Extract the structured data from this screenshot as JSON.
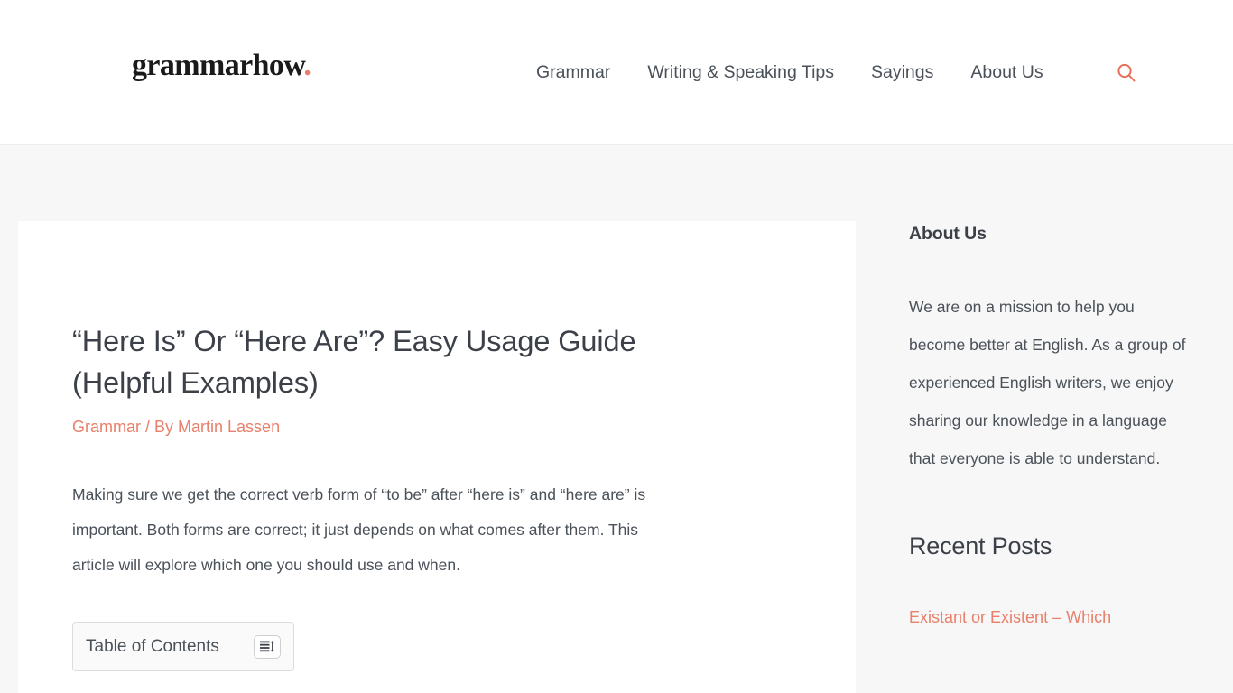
{
  "header": {
    "logo_text": "grammarhow",
    "logo_dot": ".",
    "nav": [
      {
        "label": "Grammar",
        "name": "nav-item-grammar"
      },
      {
        "label": "Writing & Speaking Tips",
        "name": "nav-item-writing-speaking-tips"
      },
      {
        "label": "Sayings",
        "name": "nav-item-sayings"
      },
      {
        "label": "About Us",
        "name": "nav-item-about-us"
      }
    ],
    "search_icon": "search-icon"
  },
  "article": {
    "title": "“Here Is” Or “Here Are”? Easy Usage Guide (Helpful Examples)",
    "meta": {
      "category": "Grammar",
      "separator": "/",
      "byline": "By Martin Lassen"
    },
    "paragraph": "Making sure we get the correct verb form of “to be” after “here is” and “here are” is important. Both forms are correct; it just depends on what comes after them. This article will explore which one you should use and when.",
    "toc": {
      "title": "Table of Contents",
      "toggle_icon": "list-toggle-icon"
    }
  },
  "sidebar": {
    "about": {
      "title": "About Us",
      "text": "We are on a mission to help you become better at English. As a group of experienced English writers, we enjoy sharing our knowledge in a language that everyone is able to understand."
    },
    "recent": {
      "title": "Recent Posts",
      "posts": [
        {
          "label": "Existant or Existent – Which"
        }
      ]
    }
  },
  "colors": {
    "accent": "#e8806b",
    "text": "#4a5159",
    "heading": "#3c4048",
    "page_background": "#f7f7f7",
    "card_background": "#ffffff",
    "border": "#ededed"
  }
}
